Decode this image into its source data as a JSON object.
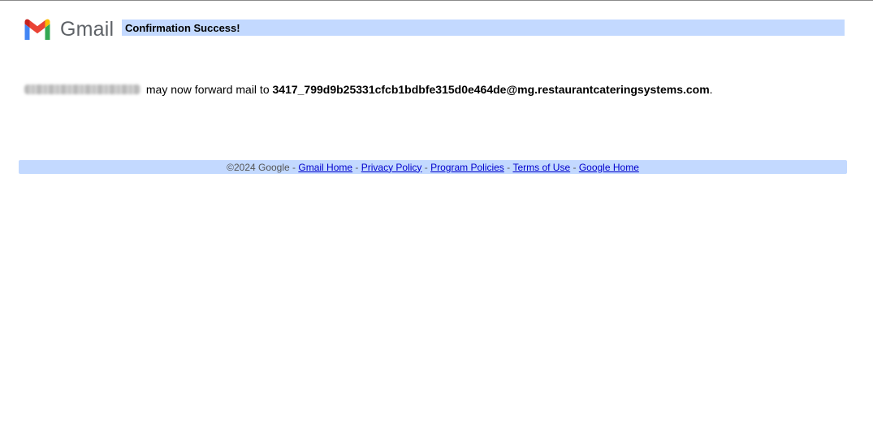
{
  "logo": {
    "text": "Gmail",
    "icon": "gmail-m-logo-icon"
  },
  "header": {
    "title": "Confirmation Success!"
  },
  "message": {
    "middle_text": " may now forward mail to ",
    "forward_address": "3417_799d9b25331cfcb1bdbfe315d0e464de@mg.restaurantcateringsystems.com",
    "end_text": "."
  },
  "footer": {
    "copyright": "©2024 Google",
    "separator": " - ",
    "links": [
      "Gmail Home",
      "Privacy Policy",
      "Program Policies",
      "Terms of Use",
      "Google Home"
    ]
  },
  "colors": {
    "bar_background": "#c3d9ff",
    "link": "#0000cc",
    "gmail_red": "#EA4335",
    "gmail_blue": "#4285F4",
    "gmail_green": "#34A853",
    "gmail_yellow": "#FBBC04"
  }
}
